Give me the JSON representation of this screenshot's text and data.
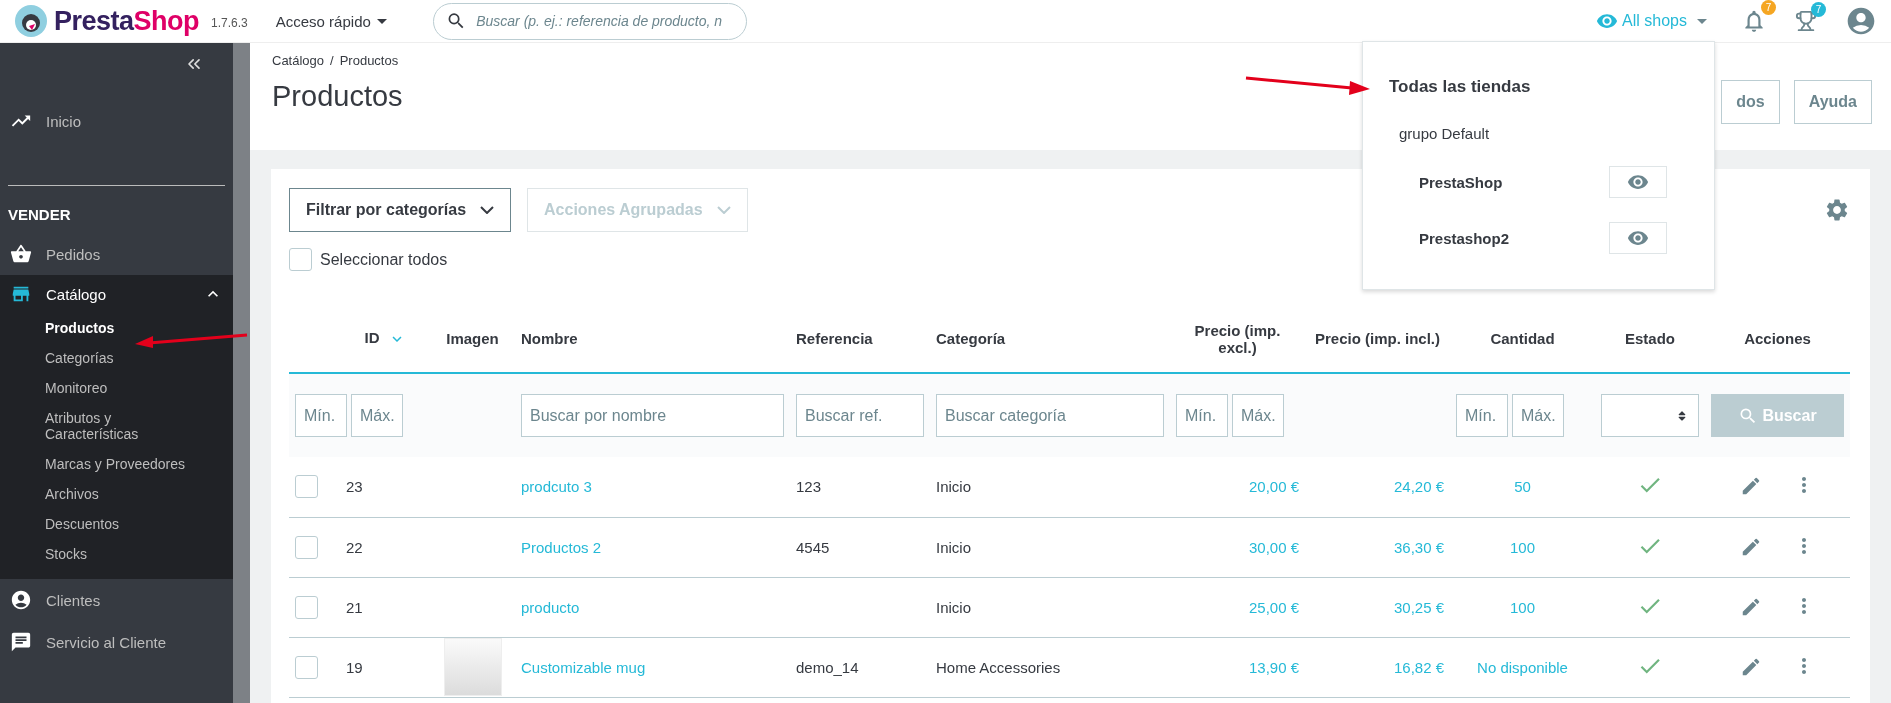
{
  "topbar": {
    "logo": {
      "parts": [
        "Presta",
        "Shop"
      ]
    },
    "version": "1.7.6.3",
    "quick_access": "Acceso rápido",
    "search": {
      "placeholder": "Buscar (p. ej.: referencia de producto, n"
    },
    "shop_selector": "All shops",
    "notifications": [
      {
        "kind": "bell",
        "count": "7",
        "color": "#f5a623"
      },
      {
        "kind": "trophy",
        "count": "7",
        "color": "#25b9d7"
      }
    ]
  },
  "sidebar": {
    "items": [
      {
        "kind": "link",
        "label": "Inicio",
        "selected": false
      },
      {
        "kind": "section",
        "label": "VENDER"
      },
      {
        "kind": "link",
        "label": "Pedidos",
        "selected": false
      },
      {
        "kind": "group",
        "label": "Catálogo",
        "expanded": true,
        "selected": true,
        "children": [
          {
            "label": "Productos",
            "selected": true
          },
          {
            "label": "Categorías",
            "selected": false
          },
          {
            "label": "Monitoreo",
            "selected": false
          },
          {
            "label": "Atributos y Características",
            "selected": false
          },
          {
            "label": "Marcas y Proveedores",
            "selected": false
          },
          {
            "label": "Archivos",
            "selected": false
          },
          {
            "label": "Descuentos",
            "selected": false
          },
          {
            "label": "Stocks",
            "selected": false
          }
        ]
      },
      {
        "kind": "link",
        "label": "Clientes",
        "selected": false
      },
      {
        "kind": "link",
        "label": "Servicio al Cliente",
        "selected": false
      }
    ]
  },
  "breadcrumb": {
    "items": [
      "Catálogo",
      "Productos"
    ],
    "separator": "/"
  },
  "title": "Productos",
  "header_buttons": [
    "dos",
    "Ayuda"
  ],
  "shop_dropdown": {
    "title": "Todas las tiendas",
    "group": "grupo Default",
    "shops": [
      "PrestaShop",
      "Prestashop2"
    ]
  },
  "toolbar": {
    "filter": "Filtrar por categorías",
    "bulk": {
      "label": "Acciones Agrupadas",
      "disabled": true
    },
    "select_all": {
      "label": "Seleccionar todos",
      "checked": false
    }
  },
  "table": {
    "columns": [
      {
        "label": "ID",
        "sorted": true
      },
      {
        "label": "Imagen",
        "sorted": false
      },
      {
        "label": "Nombre",
        "sorted": false
      },
      {
        "label": "Referencia",
        "sorted": false
      },
      {
        "label": "Categoría",
        "sorted": false
      },
      {
        "label": "Precio (imp. excl.)",
        "sorted": false
      },
      {
        "label": "Precio (imp. incl.)",
        "sorted": false
      },
      {
        "label": "Cantidad",
        "sorted": false
      },
      {
        "label": "Estado",
        "sorted": false
      },
      {
        "label": "Acciones",
        "sorted": false
      }
    ],
    "filters": [
      {
        "kind": "range",
        "placeholders": [
          "Mín.",
          "Máx."
        ]
      },
      {
        "kind": "none"
      },
      {
        "kind": "text",
        "placeholders": [
          "Buscar por nombre"
        ]
      },
      {
        "kind": "text",
        "placeholders": [
          "Buscar ref."
        ]
      },
      {
        "kind": "text",
        "placeholders": [
          "Buscar categoría"
        ]
      },
      {
        "kind": "range",
        "placeholders": [
          "Mín.",
          "Máx."
        ]
      },
      {
        "kind": "none"
      },
      {
        "kind": "range",
        "placeholders": [
          "Mín.",
          "Máx."
        ]
      },
      {
        "kind": "select"
      },
      {
        "kind": "button",
        "label": "Buscar",
        "disabled": true
      }
    ],
    "rows": [
      {
        "checked": false,
        "id": "23",
        "image": false,
        "name": "prodcuto 3",
        "reference": "123",
        "category": "Inicio",
        "price_excl": "20,00 €",
        "price_incl": "24,20 €",
        "quantity": "50",
        "active": true
      },
      {
        "checked": false,
        "id": "22",
        "image": false,
        "name": "Productos 2",
        "reference": "4545",
        "category": "Inicio",
        "price_excl": "30,00 €",
        "price_incl": "36,30 €",
        "quantity": "100",
        "active": true
      },
      {
        "checked": false,
        "id": "21",
        "image": false,
        "name": "producto",
        "category": "Inicio",
        "price_excl": "25,00 €",
        "price_incl": "30,25 €",
        "quantity": "100",
        "active": true
      },
      {
        "checked": false,
        "id": "19",
        "image": true,
        "name": "Customizable mug",
        "reference": "demo_14",
        "category": "Home Accessories",
        "price_excl": "13,90 €",
        "price_incl": "16,82 €",
        "quantity": "No disponible",
        "active": true
      }
    ]
  }
}
